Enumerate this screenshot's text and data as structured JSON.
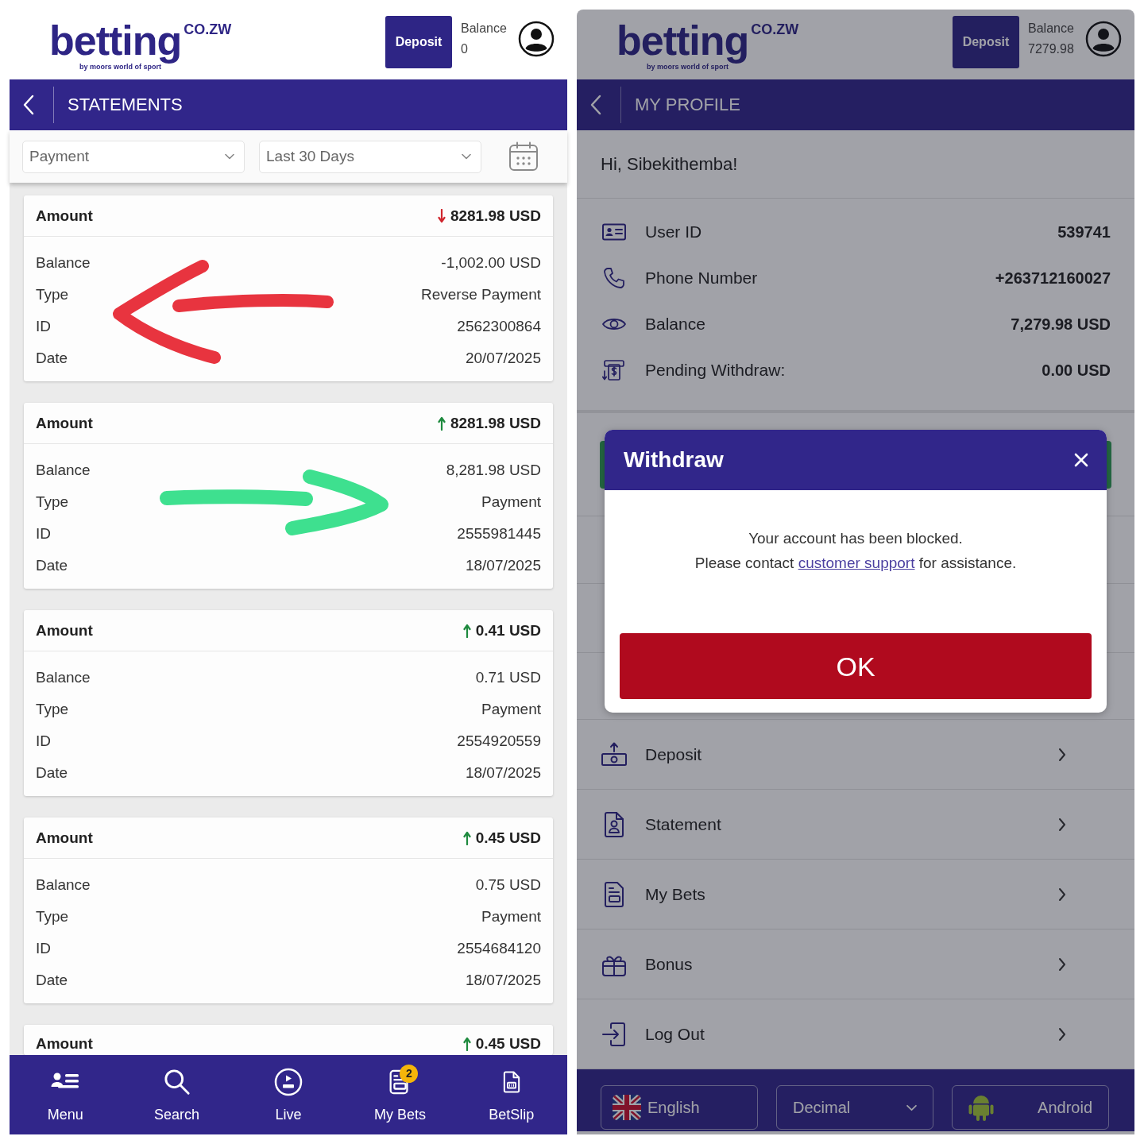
{
  "left_screen": {
    "header": {
      "logo": {
        "wordmark": "betting",
        "domain": "CO.ZW",
        "tagline": "by moors world of sport"
      },
      "deposit_button": "Deposit",
      "balance_label": "Balance",
      "balance_value": "0"
    },
    "title_bar": {
      "title": "STATEMENTS"
    },
    "filters": [
      {
        "value": "Payment"
      },
      {
        "value": "Last 30 Days"
      }
    ],
    "statements": [
      {
        "kind": "debit",
        "amount_label": "Amount",
        "amount": "8281.98 USD",
        "rows": [
          {
            "label": "Balance",
            "value": "-1,002.00 USD"
          },
          {
            "label": "Type",
            "value": "Reverse Payment"
          },
          {
            "label": "ID",
            "value": "2562300864"
          },
          {
            "label": "Date",
            "value": "20/07/2025"
          }
        ],
        "annotation": {
          "kind": "left",
          "color": "#e8343f"
        }
      },
      {
        "kind": "credit",
        "amount_label": "Amount",
        "amount": "8281.98 USD",
        "rows": [
          {
            "label": "Balance",
            "value": "8,281.98 USD"
          },
          {
            "label": "Type",
            "value": "Payment"
          },
          {
            "label": "ID",
            "value": "2555981445"
          },
          {
            "label": "Date",
            "value": "18/07/2025"
          }
        ],
        "annotation": {
          "kind": "right",
          "color": "#3ee08f"
        }
      },
      {
        "kind": "credit",
        "amount_label": "Amount",
        "amount": "0.41 USD",
        "rows": [
          {
            "label": "Balance",
            "value": "0.71 USD"
          },
          {
            "label": "Type",
            "value": "Payment"
          },
          {
            "label": "ID",
            "value": "2554920559"
          },
          {
            "label": "Date",
            "value": "18/07/2025"
          }
        ]
      },
      {
        "kind": "credit",
        "amount_label": "Amount",
        "amount": "0.45 USD",
        "rows": [
          {
            "label": "Balance",
            "value": "0.75 USD"
          },
          {
            "label": "Type",
            "value": "Payment"
          },
          {
            "label": "ID",
            "value": "2554684120"
          },
          {
            "label": "Date",
            "value": "18/07/2025"
          }
        ]
      },
      {
        "kind": "credit",
        "amount_label": "Amount",
        "amount": "0.45 USD"
      }
    ],
    "bottom_nav": [
      {
        "kind": "menu",
        "label": "Menu"
      },
      {
        "kind": "search",
        "label": "Search"
      },
      {
        "kind": "live",
        "label": "Live"
      },
      {
        "kind": "bets",
        "label": "My Bets",
        "badge": "2"
      },
      {
        "kind": "betslip",
        "label": "BetSlip"
      }
    ]
  },
  "right_screen": {
    "header": {
      "logo": {
        "wordmark": "betting",
        "domain": "CO.ZW",
        "tagline": "by moors world of sport"
      },
      "deposit_button": "Deposit",
      "balance_label": "Balance",
      "balance_value": "7279.98"
    },
    "title_bar": {
      "title": "MY PROFILE"
    },
    "greeting": "Hi, Sibekithemba!",
    "account_info": [
      {
        "kind": "userid",
        "label": "User ID",
        "value": "539741"
      },
      {
        "kind": "phone",
        "label": "Phone Number",
        "value": "+263712160027"
      },
      {
        "kind": "balance",
        "label": "Balance",
        "value": "7,279.98 USD"
      },
      {
        "kind": "pending",
        "label": "Pending Withdraw:",
        "value": "0.00 USD"
      }
    ],
    "dialog": {
      "title": "Withdraw",
      "message": {
        "line_1": "Your account has been blocked.",
        "before_link": "Please contact",
        "link": "customer support",
        "after_link": "for assistance."
      },
      "ok_button": "OK"
    },
    "menu": [
      {
        "kind": "deposit",
        "label": "Deposit"
      },
      {
        "kind": "statement",
        "label": "Statement"
      },
      {
        "kind": "bets",
        "label": "My Bets"
      },
      {
        "kind": "bonus",
        "label": "Bonus"
      },
      {
        "kind": "logout",
        "label": "Log Out"
      }
    ],
    "footer": {
      "language": "English",
      "odds_format": "Decimal",
      "app": "Android"
    }
  }
}
